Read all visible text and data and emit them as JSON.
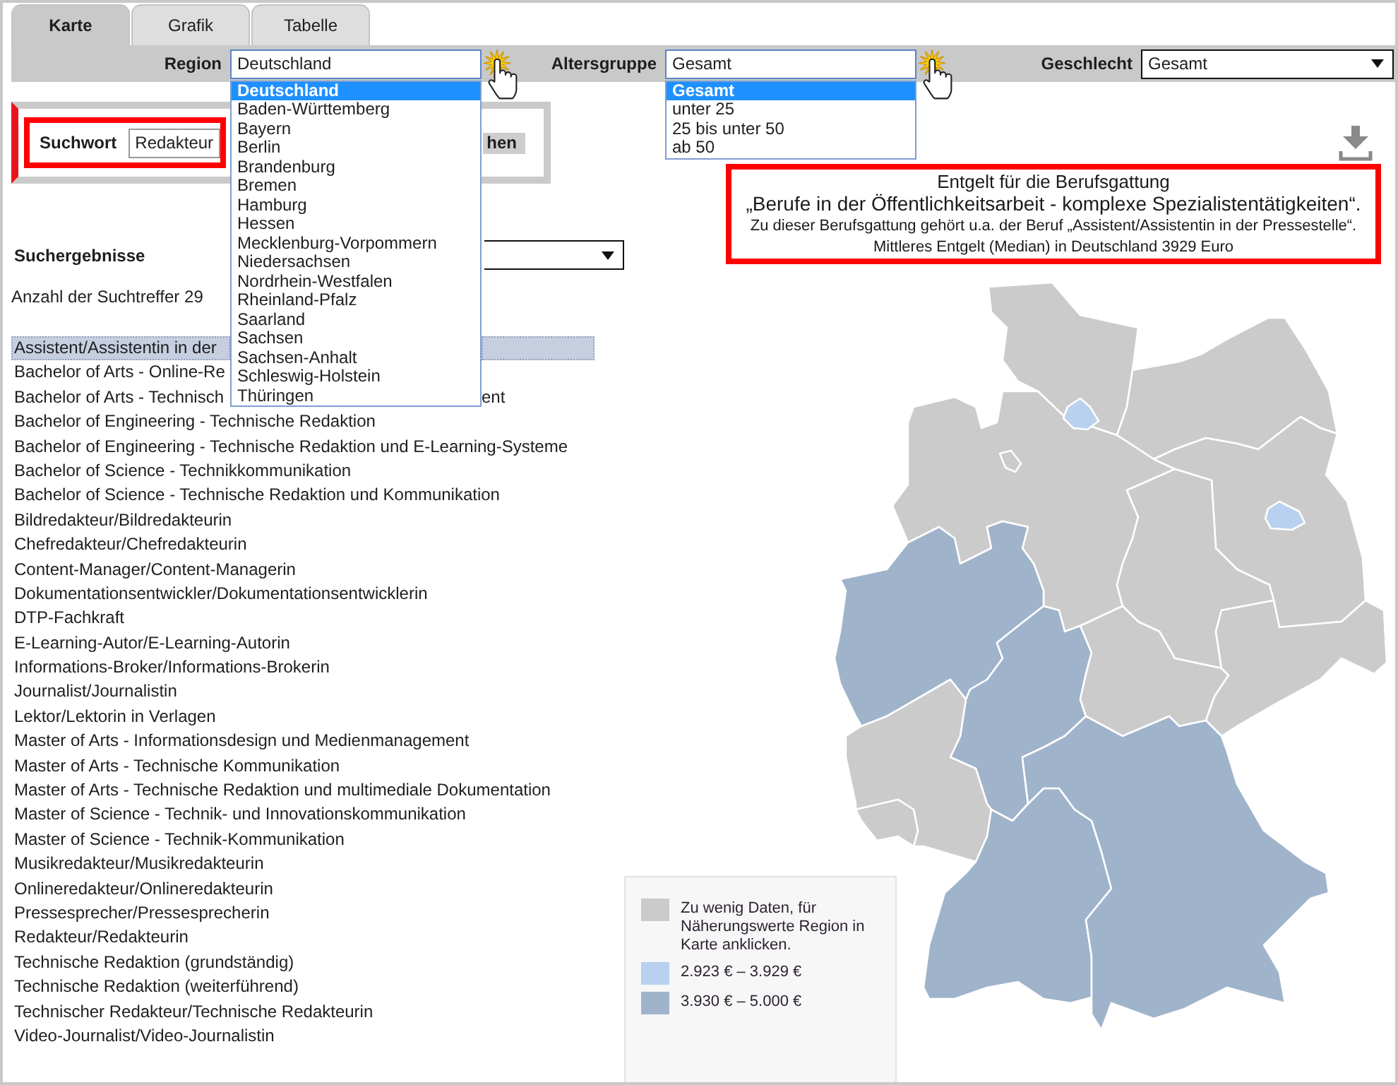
{
  "tabs": [
    {
      "label": "Karte",
      "selected": true
    },
    {
      "label": "Grafik",
      "selected": false
    },
    {
      "label": "Tabelle",
      "selected": false
    }
  ],
  "filters": [
    {
      "label": "Region",
      "value": "Deutschland",
      "open": true,
      "options": [
        {
          "label": "Deutschland",
          "selected": true
        },
        {
          "label": "Baden-Württemberg",
          "selected": false
        },
        {
          "label": "Bayern",
          "selected": false
        },
        {
          "label": "Berlin",
          "selected": false
        },
        {
          "label": "Brandenburg",
          "selected": false
        },
        {
          "label": "Bremen",
          "selected": false
        },
        {
          "label": "Hamburg",
          "selected": false
        },
        {
          "label": "Hessen",
          "selected": false
        },
        {
          "label": "Mecklenburg-Vorpommern",
          "selected": false
        },
        {
          "label": "Niedersachsen",
          "selected": false
        },
        {
          "label": "Nordrhein-Westfalen",
          "selected": false
        },
        {
          "label": "Rheinland-Pfalz",
          "selected": false
        },
        {
          "label": "Saarland",
          "selected": false
        },
        {
          "label": "Sachsen",
          "selected": false
        },
        {
          "label": "Sachsen-Anhalt",
          "selected": false
        },
        {
          "label": "Schleswig-Holstein",
          "selected": false
        },
        {
          "label": "Thüringen",
          "selected": false
        }
      ]
    },
    {
      "label": "Altersgruppe",
      "value": "Gesamt",
      "open": true,
      "options": [
        {
          "label": "Gesamt",
          "selected": true
        },
        {
          "label": "unter 25",
          "selected": false
        },
        {
          "label": "25 bis unter 50",
          "selected": false
        },
        {
          "label": "ab 50",
          "selected": false
        }
      ]
    },
    {
      "label": "Geschlecht",
      "value": "Gesamt",
      "open": false
    }
  ],
  "search": {
    "label": "Suchwort",
    "value": "Redakteur",
    "button": "hen"
  },
  "results": {
    "title": "Suchergebnisse",
    "count": "Anzahl der Suchtreffer 29",
    "items": [
      {
        "text": "Assistent/Assistentin in der",
        "selected": true
      },
      {
        "text": "Bachelor of Arts - Online-Re",
        "selected": false
      },
      {
        "text": "Bachelor of Arts - Technisch",
        "visible_end": "ent",
        "selected": false
      },
      {
        "text": "Bachelor of Engineering - Technische Redaktion",
        "selected": false
      },
      {
        "text": "Bachelor of Engineering - Technische Redaktion und E-Learning-Systeme",
        "selected": false
      },
      {
        "text": "Bachelor of Science - Technikkommunikation",
        "selected": false
      },
      {
        "text": "Bachelor of Science - Technische Redaktion und Kommunikation",
        "selected": false
      },
      {
        "text": "Bildredakteur/Bildredakteurin",
        "selected": false
      },
      {
        "text": "Chefredakteur/Chefredakteurin",
        "selected": false
      },
      {
        "text": "Content-Manager/Content-Managerin",
        "selected": false
      },
      {
        "text": "Dokumentationsentwickler/Dokumentationsentwicklerin",
        "selected": false
      },
      {
        "text": "DTP-Fachkraft",
        "selected": false
      },
      {
        "text": "E-Learning-Autor/E-Learning-Autorin",
        "selected": false
      },
      {
        "text": "Informations-Broker/Informations-Brokerin",
        "selected": false
      },
      {
        "text": "Journalist/Journalistin",
        "selected": false
      },
      {
        "text": "Lektor/Lektorin in Verlagen",
        "selected": false
      },
      {
        "text": "Master of Arts - Informationsdesign und Medienmanagement",
        "selected": false
      },
      {
        "text": "Master of Arts - Technische Kommunikation",
        "selected": false
      },
      {
        "text": "Master of Arts - Technische Redaktion und multimediale Dokumentation",
        "selected": false
      },
      {
        "text": "Master of Science - Technik- und Innovationskommunikation",
        "selected": false
      },
      {
        "text": "Master of Science - Technik-Kommunikation",
        "selected": false
      },
      {
        "text": "Musikredakteur/Musikredakteurin",
        "selected": false
      },
      {
        "text": "Onlineredakteur/Onlineredakteurin",
        "selected": false
      },
      {
        "text": "Pressesprecher/Pressesprecherin",
        "selected": false
      },
      {
        "text": "Redakteur/Redakteurin",
        "selected": false
      },
      {
        "text": "Technische Redaktion (grundständig)",
        "selected": false
      },
      {
        "text": "Technische Redaktion (weiterführend)",
        "selected": false
      },
      {
        "text": "Technischer Redakteur/Technische Redakteurin",
        "selected": false
      },
      {
        "text": "Video-Journalist/Video-Journalistin",
        "selected": false
      }
    ]
  },
  "info": {
    "heading": "Entgelt für die Berufsgattung",
    "group": "„Berufe in der Öffentlichkeitsarbeit - komplexe Spezialistentätigkeiten“.",
    "note": "Zu dieser Berufsgattung gehört u.a. der Beruf „Assistent/Assistentin in der Pressestelle“.",
    "median": "Mittleres Entgelt (Median) in Deutschland 3929 Euro"
  },
  "map": {
    "regions": [
      {
        "color": "#cbcbcb"
      },
      {
        "color": "#cbcbcb"
      },
      {
        "color": "#cbcbcb"
      },
      {
        "color": "#cbcbcb"
      },
      {
        "color": "#cbcbcb"
      },
      {
        "color": "#9fb3cb"
      },
      {
        "color": "#9fb3cb"
      },
      {
        "color": "#cbcbcb"
      },
      {
        "color": "#cbcbcb"
      },
      {
        "color": "#cbcbcb"
      },
      {
        "color": "#cbcbcb"
      },
      {
        "color": "#9fb3cb"
      },
      {
        "color": "#9fb3cb"
      },
      {
        "color": "#cbcbcb"
      },
      {
        "color": "#b8d1ee"
      },
      {
        "color": "#b8d1ee"
      }
    ]
  },
  "legend": [
    {
      "color": "#cbcbcb",
      "label": "Zu wenig Daten, für Näherungswerte Region in Karte anklicken."
    },
    {
      "color": "#b8d1ee",
      "label": "2.923 € – 3.929 €"
    },
    {
      "color": "#9fb3cb",
      "label": "3.930 € – 5.000 €"
    }
  ]
}
